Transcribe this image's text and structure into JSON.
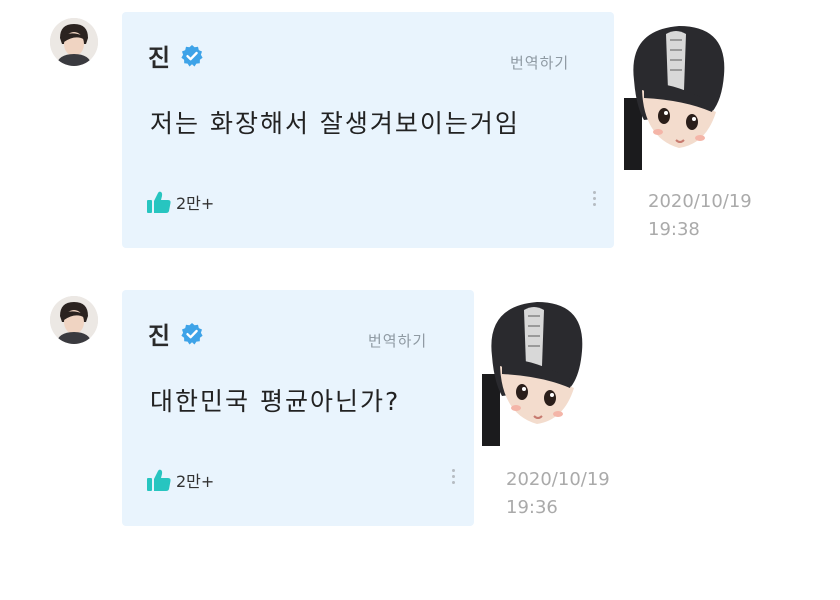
{
  "messages": [
    {
      "author": "진",
      "translate_label": "번역하기",
      "text": "저는 화장해서 잘생겨보이는거임",
      "likes": "2만+",
      "date": "2020/10/19",
      "time": "19:38"
    },
    {
      "author": "진",
      "translate_label": "번역하기",
      "text": "대한민국 평균아닌가?",
      "likes": "2만+",
      "date": "2020/10/19",
      "time": "19:36"
    }
  ],
  "icons": {
    "verified": "verified-badge-icon",
    "like": "thumbs-up-icon",
    "more": "kebab-menu-icon",
    "sticker": "character-sticker"
  },
  "colors": {
    "card_bg": "#e9f4fd",
    "verified_blue": "#3ea3e8",
    "like_teal": "#27c5c0",
    "timestamp": "#aaaaaa"
  }
}
